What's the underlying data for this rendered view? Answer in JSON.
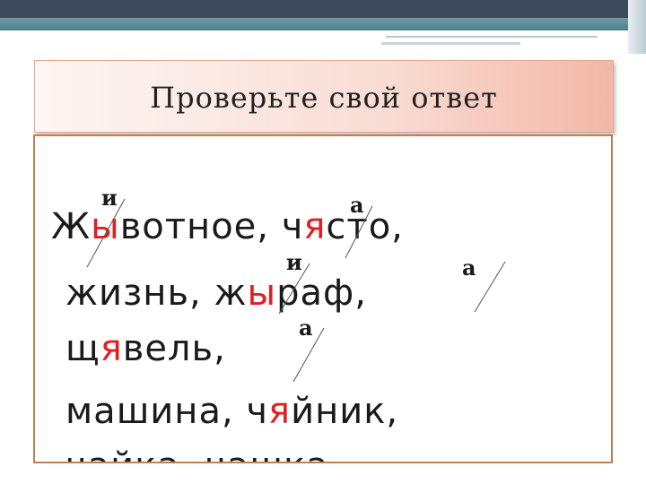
{
  "title": "Проверьте свой ответ",
  "corrections": [
    "и",
    "а",
    "и",
    "а",
    "а"
  ],
  "lines": [
    [
      {
        "t": "Ж"
      },
      {
        "t": "ы",
        "hl": true
      },
      {
        "t": "вотное,  "
      },
      {
        "t": "ч"
      },
      {
        "t": "я",
        "hl": true
      },
      {
        "t": "сто,"
      }
    ],
    [
      {
        "t": "жизнь, ж"
      },
      {
        "t": "ы",
        "hl": true
      },
      {
        "t": "раф,"
      }
    ],
    [
      {
        "t": "щ"
      },
      {
        "t": "я",
        "hl": true
      },
      {
        "t": "вель,"
      }
    ],
    [
      {
        "t": "машина, ч"
      },
      {
        "t": "я",
        "hl": true
      },
      {
        "t": "йник,"
      }
    ],
    [
      {
        "t": "чайка, чашка"
      }
    ]
  ],
  "colors": {
    "highlight": "#e02020",
    "frame": "#c08050",
    "header": "#3c4a5c",
    "accent": "#4f7f8a"
  }
}
